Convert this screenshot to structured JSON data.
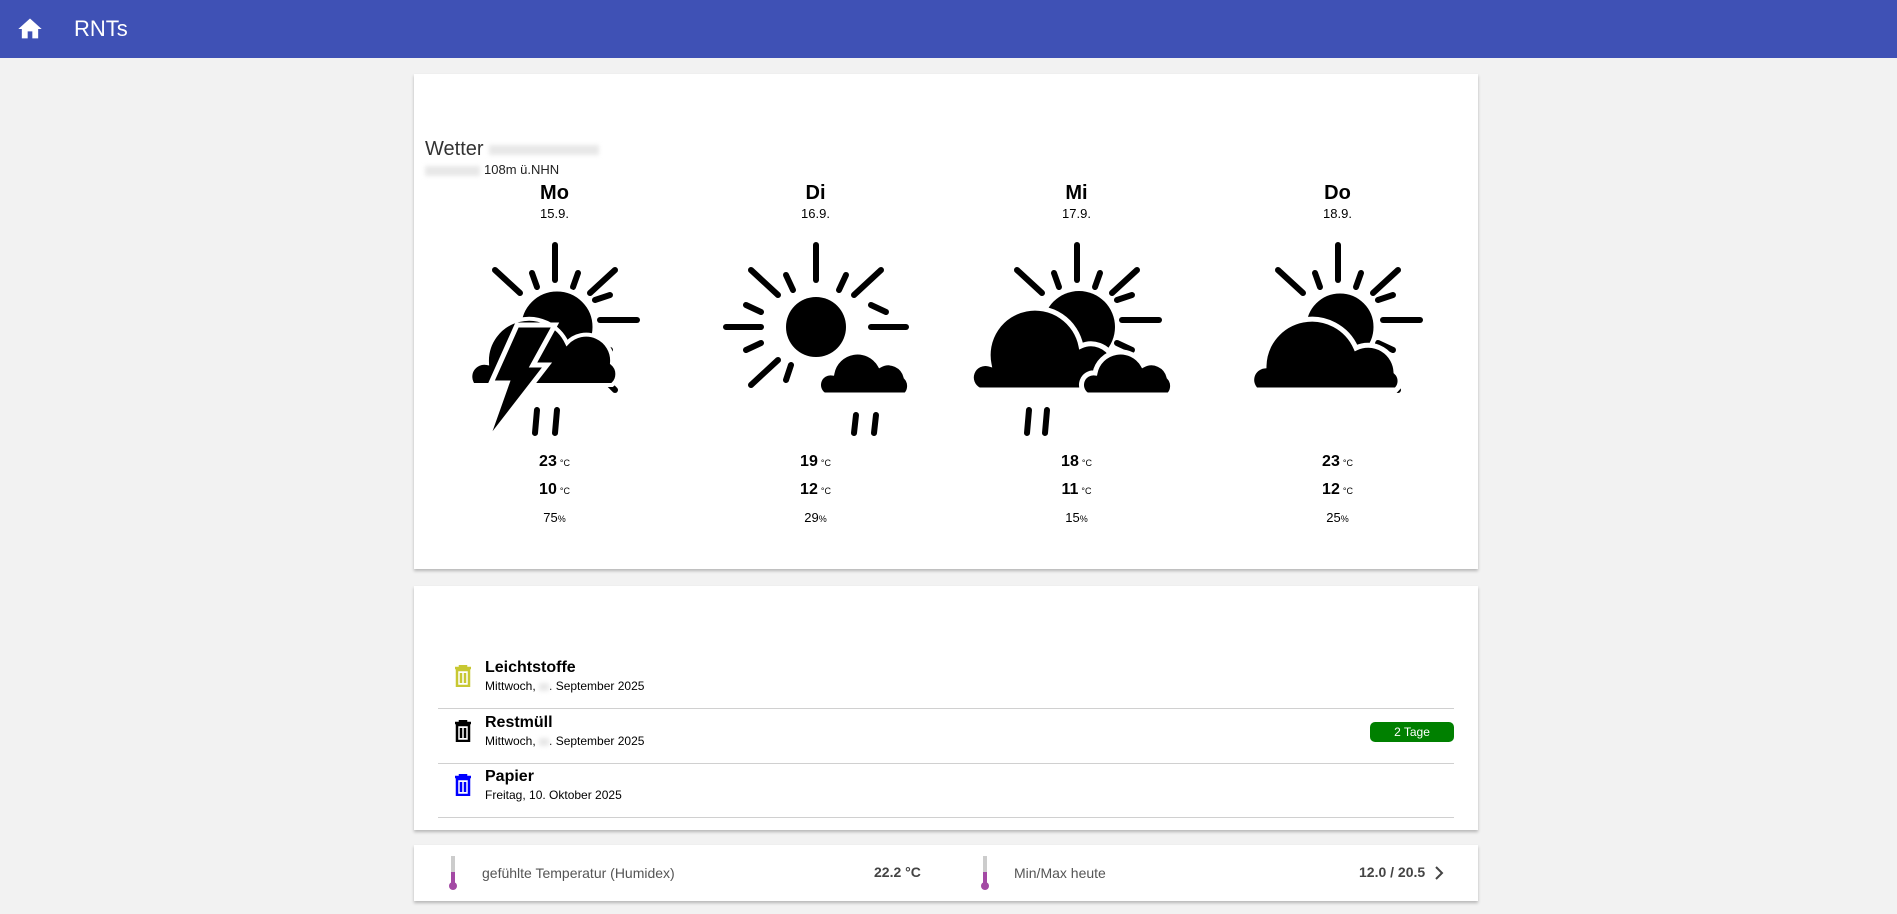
{
  "header": {
    "title": "RNTs",
    "home_icon": "home-icon"
  },
  "weather": {
    "title": "Wetter",
    "subtitle": "108m ü.NHN",
    "temp_unit": "°C",
    "precip_unit": "%",
    "days": [
      {
        "name": "Mo",
        "date": "15.9.",
        "icon": "thunderstorm-sun-cloud-rain",
        "max": "23",
        "min": "10",
        "precip": "75"
      },
      {
        "name": "Di",
        "date": "16.9.",
        "icon": "sun-cloud-rain",
        "max": "19",
        "min": "12",
        "precip": "29"
      },
      {
        "name": "Mi",
        "date": "17.9.",
        "icon": "sun-clouds-rain",
        "max": "18",
        "min": "11",
        "precip": "15"
      },
      {
        "name": "Do",
        "date": "18.9.",
        "icon": "sun-cloud",
        "max": "23",
        "min": "12",
        "precip": "25"
      }
    ]
  },
  "waste": [
    {
      "name": "Leichtstoffe",
      "date_prefix": "Mittwoch,",
      "date_suffix": ". September 2025",
      "color": "#c8c832"
    },
    {
      "name": "Restmüll",
      "date_prefix": "Mittwoch,",
      "date_suffix": ". September 2025",
      "color": "#000000",
      "badge": "2 Tage",
      "badge_color": "#008000"
    },
    {
      "name": "Papier",
      "date_prefix": "Freitag, 10. Oktober 2025",
      "date_suffix": "",
      "color": "#0000ff"
    }
  ],
  "sensors": [
    {
      "label": "gefühlte Temperatur (Humidex)",
      "value": "22.2 °C"
    },
    {
      "label": "Min/Max heute",
      "value": "12.0 / 20.5"
    }
  ]
}
